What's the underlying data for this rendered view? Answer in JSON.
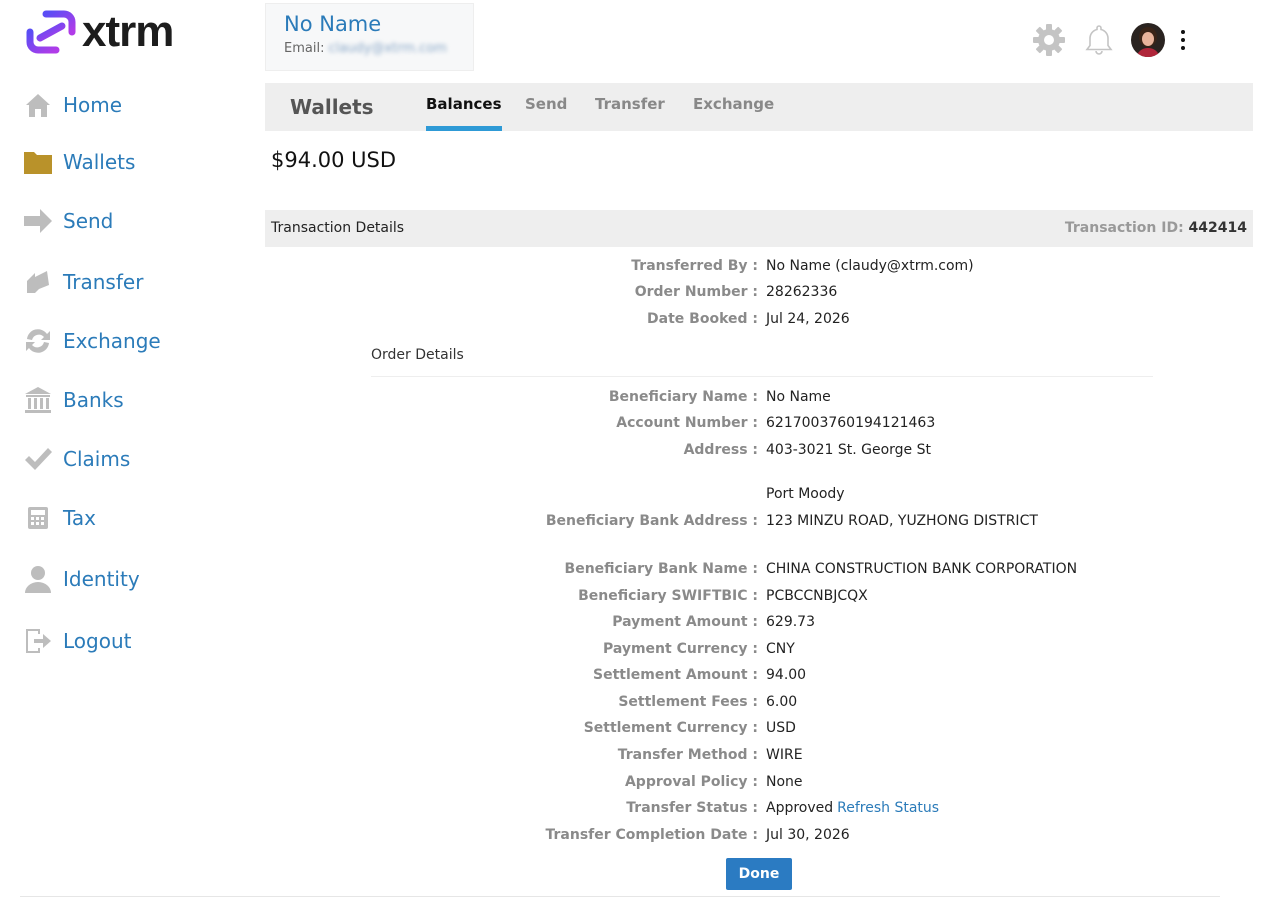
{
  "brand": {
    "name": "xtrm",
    "accent": "#7b3ff2",
    "link_color": "#2b7bb9"
  },
  "sidebar": {
    "items": [
      {
        "label": "Home",
        "icon": "home-icon"
      },
      {
        "label": "Wallets",
        "icon": "folder-icon"
      },
      {
        "label": "Send",
        "icon": "arrow-right-icon"
      },
      {
        "label": "Transfer",
        "icon": "transfer-icon"
      },
      {
        "label": "Exchange",
        "icon": "exchange-icon"
      },
      {
        "label": "Banks",
        "icon": "bank-icon"
      },
      {
        "label": "Claims",
        "icon": "checkmark-icon"
      },
      {
        "label": "Tax",
        "icon": "calculator-icon"
      },
      {
        "label": "Identity",
        "icon": "person-icon"
      },
      {
        "label": "Logout",
        "icon": "logout-icon"
      }
    ]
  },
  "user": {
    "name": "No Name",
    "email_label": "Email:",
    "email": "claudy@xtrm.com"
  },
  "tabs": {
    "title": "Wallets",
    "items": [
      "Balances",
      "Send",
      "Transfer",
      "Exchange"
    ],
    "active": "Balances"
  },
  "balance": "$94.00 USD",
  "transaction": {
    "header_title": "Transaction Details",
    "id_label": "Transaction ID:",
    "id_value": "442414",
    "summary": [
      {
        "label": "Transferred By :",
        "value": "No Name (claudy@xtrm.com)"
      },
      {
        "label": "Order Number :",
        "value": "28262336"
      },
      {
        "label": "Date Booked :",
        "value": "Jul 24, 2026"
      }
    ],
    "order_details_label": "Order Details",
    "details": [
      {
        "label": "Beneficiary Name :",
        "value": "No Name"
      },
      {
        "label": "Account Number :",
        "value": "6217003760194121463"
      },
      {
        "label": "Address :",
        "value": "403-3021 St. George St"
      },
      {
        "label": "",
        "value": "Port Moody"
      },
      {
        "label": "Beneficiary Bank Address :",
        "value": "123 MINZU ROAD, YUZHONG DISTRICT"
      },
      {
        "label": "Beneficiary Bank Name :",
        "value": "CHINA CONSTRUCTION BANK CORPORATION"
      },
      {
        "label": "Beneficiary SWIFTBIC :",
        "value": "PCBCCNBJCQX"
      },
      {
        "label": "Payment Amount :",
        "value": "629.73"
      },
      {
        "label": "Payment Currency :",
        "value": "CNY"
      },
      {
        "label": "Settlement Amount :",
        "value": "94.00"
      },
      {
        "label": "Settlement Fees :",
        "value": "6.00"
      },
      {
        "label": "Settlement Currency :",
        "value": "USD"
      },
      {
        "label": "Transfer Method :",
        "value": "WIRE"
      },
      {
        "label": "Approval Policy :",
        "value": "None"
      },
      {
        "label": "Transfer Status :",
        "value": "Approved",
        "link": "Refresh Status"
      },
      {
        "label": "Transfer Completion Date :",
        "value": "Jul 30, 2026"
      }
    ],
    "done_label": "Done"
  }
}
